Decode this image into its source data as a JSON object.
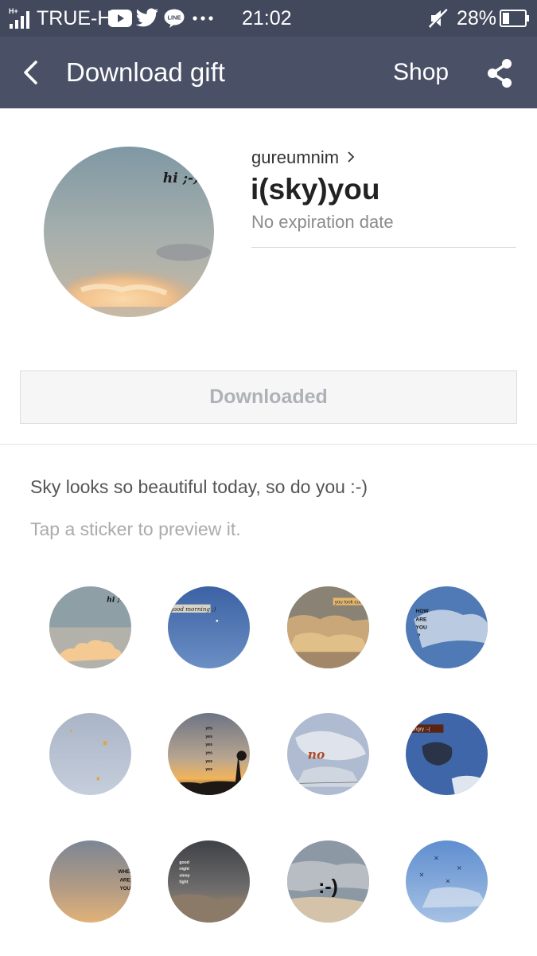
{
  "status_bar": {
    "carrier": "TRUE-H",
    "time": "21:02",
    "battery": "28%",
    "icons": [
      "signal-icon",
      "youtube-icon",
      "twitter-icon",
      "line-icon",
      "more-icon",
      "mute-icon",
      "battery-icon"
    ]
  },
  "header": {
    "title": "Download gift",
    "shop_label": "Shop",
    "back_icon": "back-arrow-icon",
    "share_icon": "share-icon"
  },
  "product": {
    "author": "gureumnim",
    "title": "i(sky)you",
    "expiration": "No expiration date",
    "thumbnail_text": "hi ;-)",
    "button_label": "Downloaded"
  },
  "description": "Sky looks so beautiful today, so do you :-)",
  "hint": "Tap a sticker to preview it.",
  "stickers": [
    {
      "name": "sticker-hi-sunset-cloud",
      "text": "hi ;-)"
    },
    {
      "name": "sticker-good-morning-blue",
      "text": "good morning ;)"
    },
    {
      "name": "sticker-golden-clouds",
      "text": "you look cute"
    },
    {
      "name": "sticker-how-are-you",
      "text": "HOW ARE YOU ?"
    },
    {
      "name": "sticker-pale-sky-birds",
      "text": ""
    },
    {
      "name": "sticker-yes-sunset-tree",
      "text": "yes yes yes yes yes yes"
    },
    {
      "name": "sticker-no-cloud",
      "text": "no"
    },
    {
      "name": "sticker-hungry-dark-cloud",
      "text": "hungry :-("
    },
    {
      "name": "sticker-where-are-you",
      "text": "WHERE ARE YOU"
    },
    {
      "name": "sticker-good-night-dark",
      "text": "good night sleep tight"
    },
    {
      "name": "sticker-smiley-cloud",
      "text": ":-)"
    },
    {
      "name": "sticker-birds-blue",
      "text": ""
    }
  ],
  "colors": {
    "status_bar": "#42495d",
    "header": "#4a5167",
    "button_text": "#aeb1b8"
  }
}
